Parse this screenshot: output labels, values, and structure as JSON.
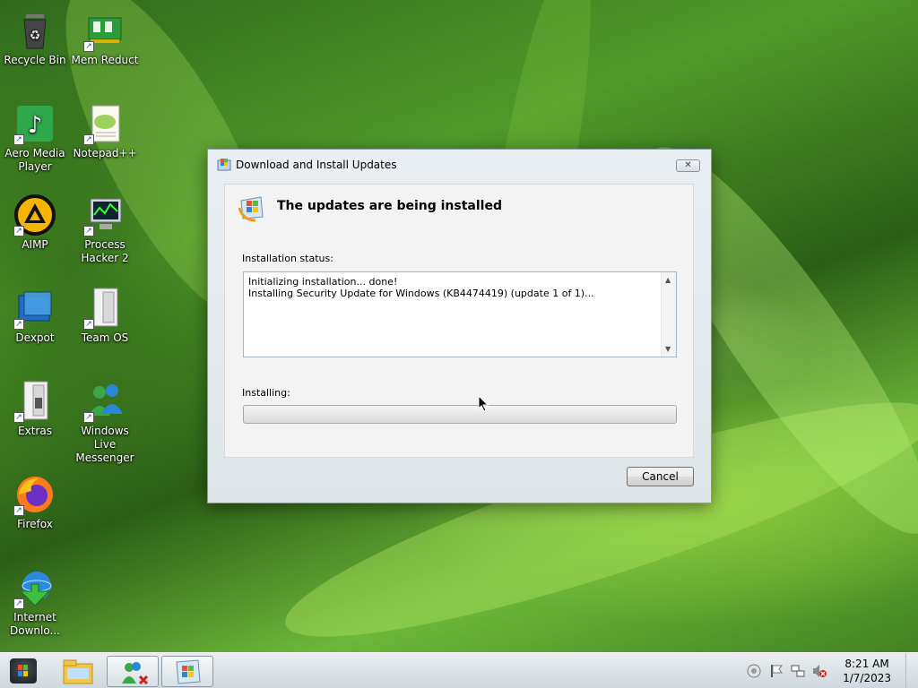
{
  "desktop": {
    "icons": [
      {
        "label": "Recycle Bin",
        "icon": "recycle-bin-icon"
      },
      {
        "label": "Mem Reduct",
        "icon": "memory-chip-icon"
      },
      {
        "label": "Aero Media Player",
        "icon": "music-note-icon"
      },
      {
        "label": "Notepad++",
        "icon": "notepad-icon"
      },
      {
        "label": "AIMP",
        "icon": "aimp-triangle-icon"
      },
      {
        "label": "Process Hacker 2",
        "icon": "computer-monitor-icon"
      },
      {
        "label": "Dexpot",
        "icon": "dexpot-icon"
      },
      {
        "label": "Team OS",
        "icon": "folder-icon"
      },
      {
        "label": "Extras",
        "icon": "folder-icon"
      },
      {
        "label": "Windows Live Messenger",
        "icon": "messenger-icon"
      },
      {
        "label": "Firefox",
        "icon": "firefox-icon"
      },
      {
        "label": "Internet Downlo...",
        "icon": "download-globe-icon"
      }
    ]
  },
  "dialog": {
    "title": "Download and Install Updates",
    "close_glyph": "✕",
    "heading": "The updates are being installed",
    "status_label": "Installation status:",
    "status_lines": [
      "Initializing installation... done!",
      "Installing Security Update for Windows (KB4474419) (update 1 of 1)..."
    ],
    "progress_label": "Installing:",
    "progress": 0,
    "cancel_label": "Cancel"
  },
  "taskbar": {
    "time": "8:21 AM",
    "date": "1/7/2023",
    "buttons": [
      "explorer-icon",
      "messenger-icon",
      "windows-update-icon"
    ],
    "tray": [
      "network-circle-icon",
      "flag-icon",
      "network-icon",
      "volume-muted-icon"
    ]
  },
  "colors": {
    "accent_green": "#2fb32f",
    "dialog_bg": "#e9eef2"
  }
}
